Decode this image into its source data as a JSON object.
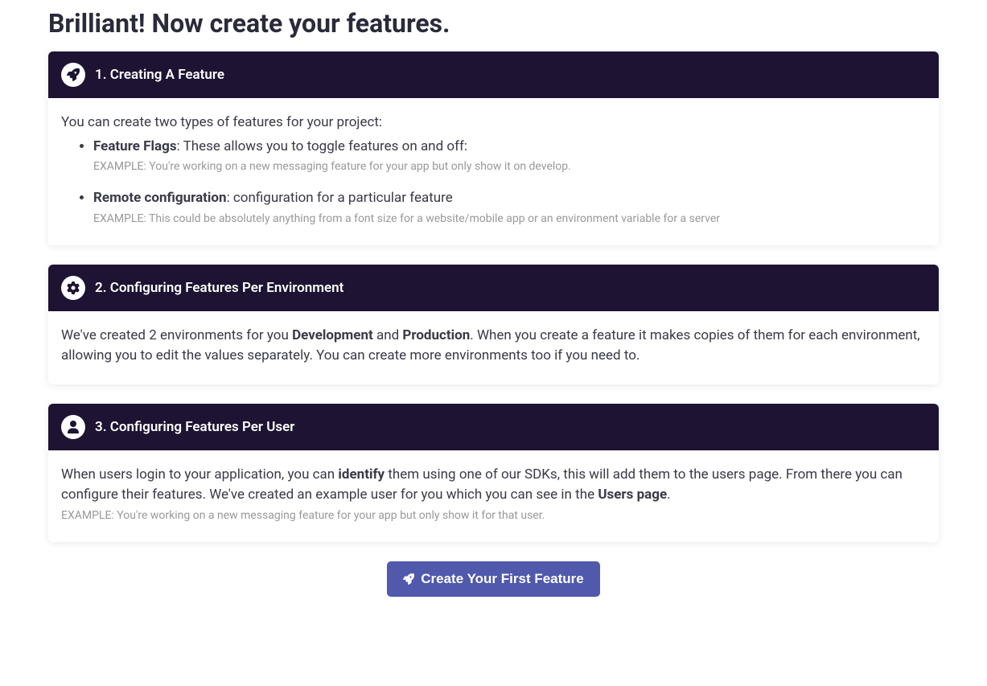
{
  "page_title": "Brilliant! Now create your features.",
  "sections": [
    {
      "icon": "rocket",
      "title": "1. Creating A Feature",
      "intro": "You can create two types of features for your project:",
      "bullets": [
        {
          "name": "Feature Flags",
          "desc": ": These allows you to toggle features on and off:",
          "example": "EXAMPLE: You're working on a new messaging feature for your app but only show it on develop."
        },
        {
          "name": "Remote configuration",
          "desc": ": configuration for a particular feature",
          "example": "EXAMPLE: This could be absolutely anything from a font size for a website/mobile app or an environment variable for a server"
        }
      ]
    },
    {
      "icon": "gear",
      "title": "2. Configuring Features Per Environment",
      "body_parts": {
        "p1": "We've created 2 environments for you ",
        "b1": "Development",
        "p2": " and ",
        "b2": "Production",
        "p3": ". When you create a feature it makes copies of them for each environment, allowing you to edit the values separately. You can create more environments too if you need to."
      }
    },
    {
      "icon": "user",
      "title": "3. Configuring Features Per User",
      "body_parts": {
        "p1": "When users login to your application, you can ",
        "b1": "identify",
        "p2": " them using one of our SDKs, this will add them to the users page. From there you can configure their features. We've created an example user for you which you can see in the ",
        "b2": "Users page",
        "p3": "."
      },
      "example": "EXAMPLE: You're working on a new messaging feature for your app but only show it for that user."
    }
  ],
  "cta": {
    "label": "Create Your First Feature"
  }
}
